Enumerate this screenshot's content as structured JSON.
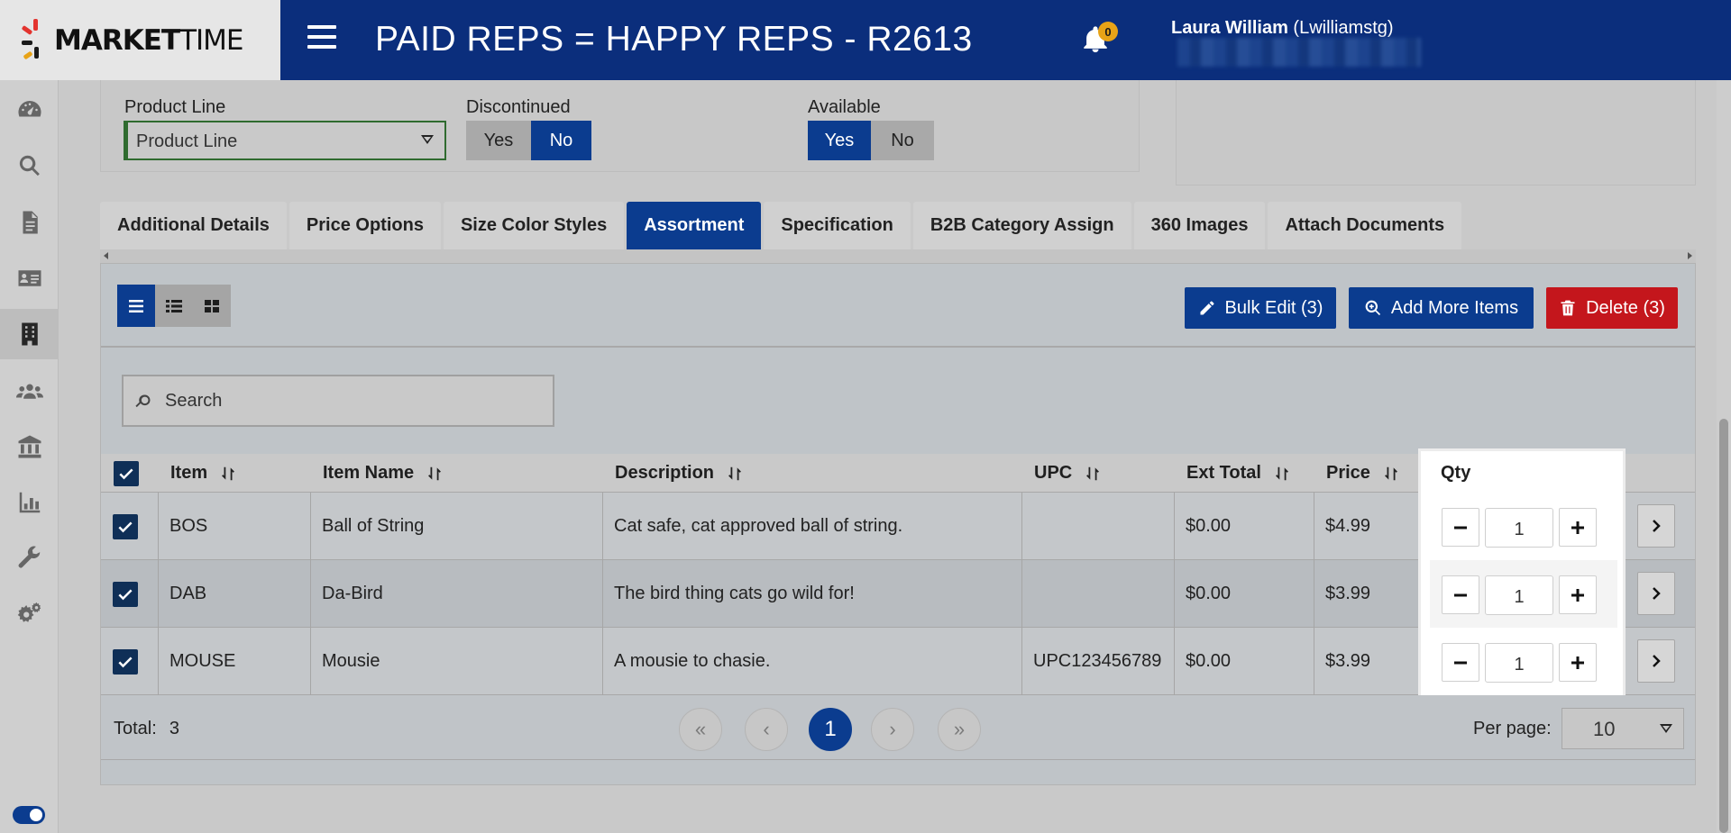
{
  "brand": {
    "logo_bold": "MARKET",
    "logo_light": "TIME"
  },
  "header": {
    "title": "PAID REPS = HAPPY REPS - R2613",
    "notification_count": "0",
    "user_name": "Laura William",
    "user_login": "(Lwilliamstg)"
  },
  "sidebar": {
    "icons": [
      "dashboard-icon",
      "search-icon",
      "document-icon",
      "contact-card-icon",
      "building-icon",
      "users-icon",
      "bank-icon",
      "chart-icon",
      "wrench-icon",
      "gears-icon"
    ],
    "active": "building-icon"
  },
  "filters": {
    "product_line_label": "Product Line",
    "product_line_value": "Product Line",
    "discontinued_label": "Discontinued",
    "available_label": "Available",
    "yes": "Yes",
    "no": "No",
    "discontinued_selected": "No",
    "available_selected": "Yes"
  },
  "tabs": [
    "Additional Details",
    "Price Options",
    "Size Color Styles",
    "Assortment",
    "Specification",
    "B2B Category Assign",
    "360 Images",
    "Attach Documents"
  ],
  "active_tab": "Assortment",
  "toolbar": {
    "bulk_edit": "Bulk Edit (3)",
    "add_more": "Add More Items",
    "delete": "Delete (3)"
  },
  "search": {
    "placeholder": "Search"
  },
  "table": {
    "columns": {
      "item": "Item",
      "item_name": "Item Name",
      "description": "Description",
      "upc": "UPC",
      "ext_total": "Ext Total",
      "price": "Price",
      "qty": "Qty"
    },
    "rows": [
      {
        "item": "BOS",
        "item_name": "Ball of String",
        "description": "Cat safe, cat approved ball of string.",
        "upc": "",
        "ext_total": "$0.00",
        "price": "$4.99",
        "qty": "1",
        "checked": true
      },
      {
        "item": "DAB",
        "item_name": "Da-Bird",
        "description": "The bird thing cats go wild for!",
        "upc": "",
        "ext_total": "$0.00",
        "price": "$3.99",
        "qty": "1",
        "checked": true
      },
      {
        "item": "MOUSE",
        "item_name": "Mousie",
        "description": "A mousie to chasie.",
        "upc": "UPC123456789",
        "ext_total": "$0.00",
        "price": "$3.99",
        "qty": "1",
        "checked": true
      }
    ]
  },
  "footer": {
    "total_label": "Total:",
    "total_value": "3",
    "first": "«",
    "prev": "‹",
    "current_page": "1",
    "next": "›",
    "last": "»",
    "per_page_label": "Per page:",
    "per_page_value": "10"
  },
  "colors": {
    "primary": "#0b3c8f",
    "header": "#0b2e7c",
    "danger": "#c4161c",
    "badge": "#e8a317"
  }
}
